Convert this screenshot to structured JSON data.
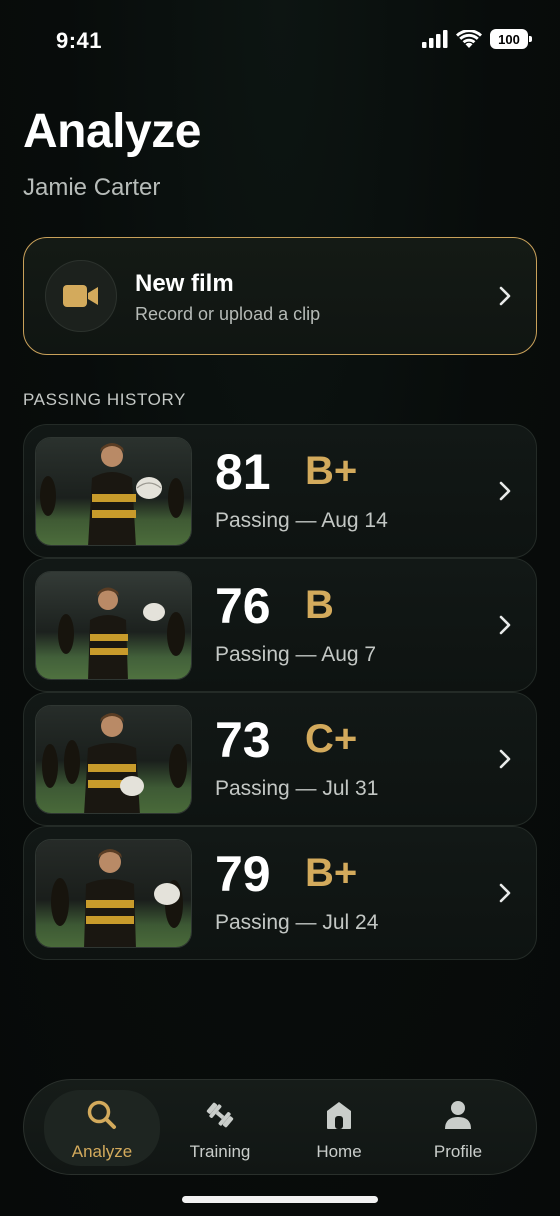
{
  "status_bar": {
    "time": "9:41",
    "battery": "100"
  },
  "header": {
    "title": "Analyze",
    "user_name": "Jamie Carter"
  },
  "new_film": {
    "title": "New film",
    "subtitle": "Record or upload a clip",
    "icon": "video-camera-icon"
  },
  "history": {
    "section_label": "PASSING HISTORY",
    "items": [
      {
        "score": "81",
        "grade": "B+",
        "label": "Passing — Aug 14"
      },
      {
        "score": "76",
        "grade": "B",
        "label": "Passing — Aug 7"
      },
      {
        "score": "73",
        "grade": "C+",
        "label": "Passing — Jul 31"
      },
      {
        "score": "79",
        "grade": "B+",
        "label": "Passing — Jul 24"
      }
    ]
  },
  "tab_bar": {
    "tabs": [
      {
        "label": "Analyze",
        "icon": "search-icon",
        "active": true
      },
      {
        "label": "Training",
        "icon": "dumbbell-icon",
        "active": false
      },
      {
        "label": "Home",
        "icon": "home-icon",
        "active": false
      },
      {
        "label": "Profile",
        "icon": "person-icon",
        "active": false
      }
    ]
  },
  "colors": {
    "accent": "#d3aa5c",
    "background": "#080c0b",
    "card_border": "#c9a15a"
  }
}
